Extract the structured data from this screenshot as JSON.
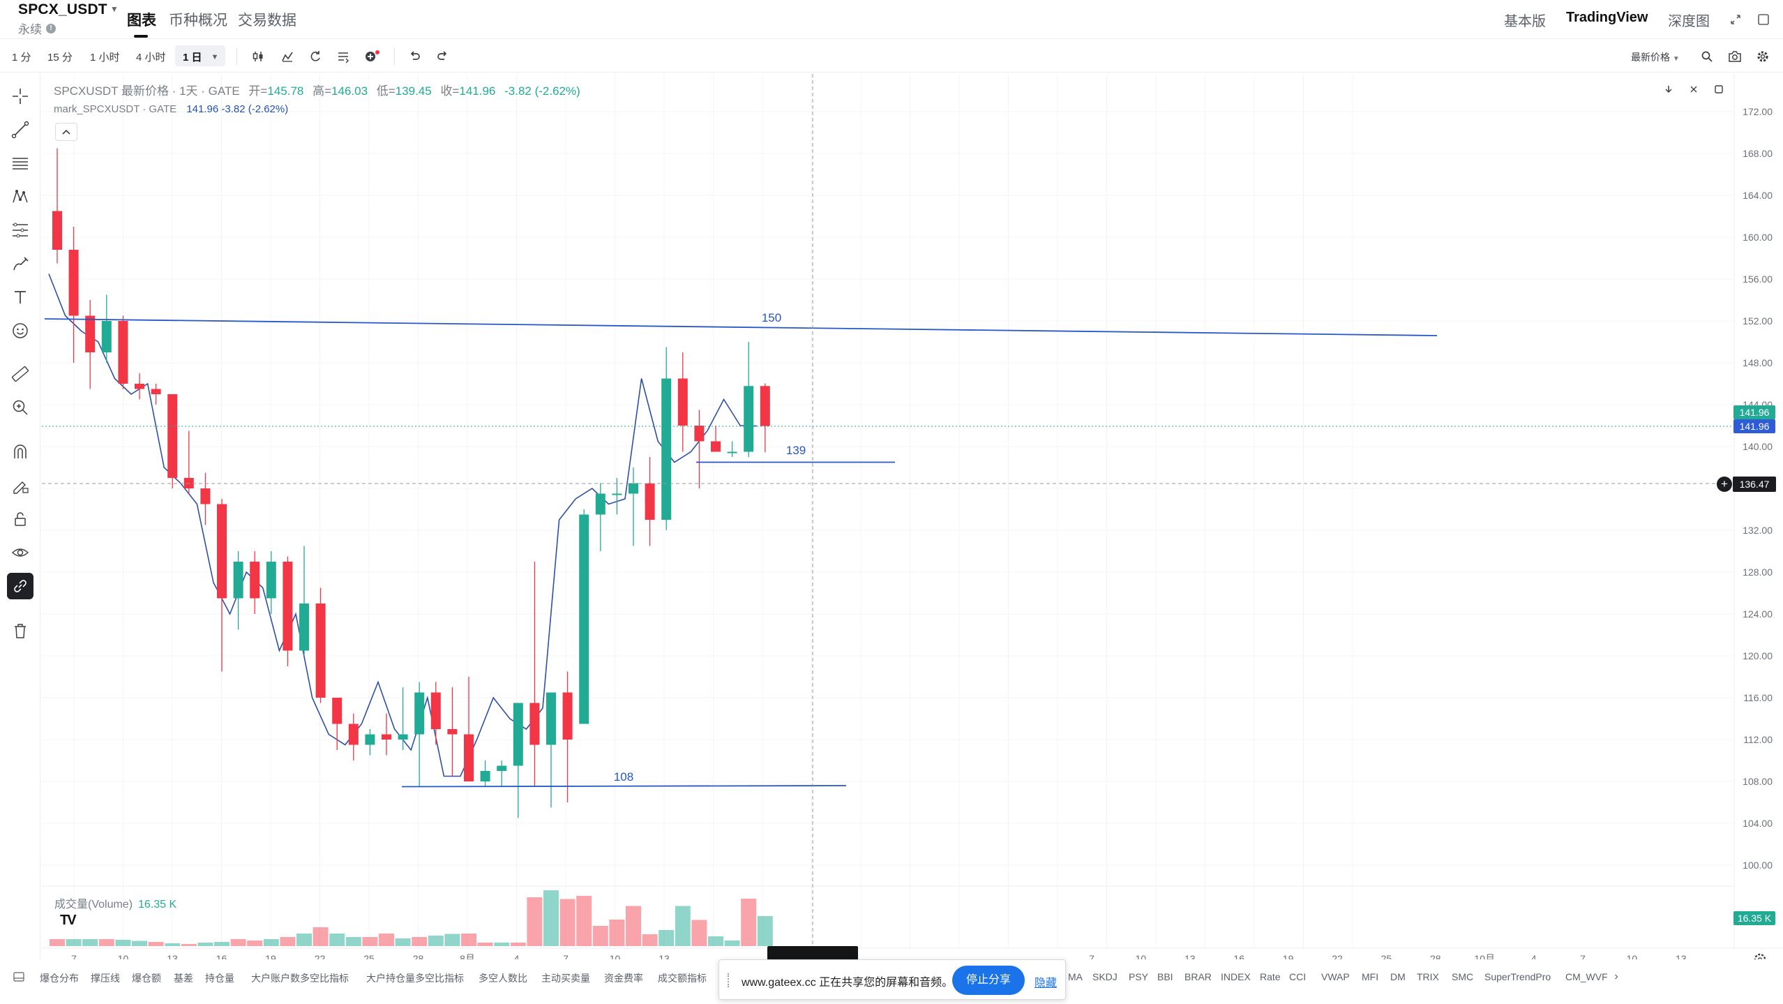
{
  "header": {
    "symbol": "SPCX_USDT",
    "subtype": "永续",
    "tabs": [
      "图表",
      "币种概况",
      "交易数据"
    ],
    "right_modes": [
      "基本版",
      "TradingView",
      "深度图"
    ]
  },
  "toolbar": {
    "timeframes": [
      "1 分",
      "15 分",
      "1 小时",
      "4 小时",
      "1 日"
    ],
    "price_source": "最新价格"
  },
  "legend": {
    "title": "SPCXUSDT 最新价格 · 1天 · GATE",
    "open_label": "开=",
    "open": "145.78",
    "high_label": "高=",
    "high": "146.03",
    "low_label": "低=",
    "low": "139.45",
    "close_label": "收=",
    "close": "141.96",
    "change": "-3.82 (-2.62%)",
    "mark_title": "mark_SPCXUSDT · GATE",
    "mark_value": "141.96 -3.82 (-2.62%)"
  },
  "volume_legend": {
    "label": "成交量(Volume)",
    "value": "16.35 K"
  },
  "price_tags": {
    "last_price": "141.96",
    "mark_price": "141.96",
    "crosshair_price": "136.47",
    "volume_tag": "16.35 K"
  },
  "colors": {
    "up": "#22ab94",
    "down": "#f23645",
    "drawing": "#2855c8",
    "mark_line": "#2c4fa8",
    "crosshair": "#9598a1"
  },
  "chart_data": {
    "type": "candlestick",
    "y_ticks": [
      "172.00",
      "168.00",
      "164.00",
      "160.00",
      "156.00",
      "152.00",
      "148.00",
      "144.00",
      "140.00",
      "136.00",
      "132.00",
      "128.00",
      "124.00",
      "120.00",
      "116.00",
      "112.00",
      "108.00",
      "104.00",
      "100.00"
    ],
    "x_ticks": [
      "7",
      "10",
      "13",
      "16",
      "19",
      "22",
      "25",
      "28",
      "8月",
      "4",
      "7",
      "10",
      "13",
      "16",
      "19",
      "22",
      "25",
      "28",
      "10月",
      "4",
      "7",
      "10",
      "13",
      "16"
    ],
    "x_ticks_visible": [
      "7",
      "10",
      "13",
      "16",
      "19",
      "22",
      "25",
      "28",
      "8月",
      "4",
      "7",
      "10",
      "13",
      "7",
      "10",
      "13",
      "16",
      "19",
      "22",
      "25",
      "28",
      "10月",
      "4",
      "7",
      "10",
      "13"
    ],
    "ohlc": [
      [
        162.5,
        168.5,
        157.5,
        158.8
      ],
      [
        158.8,
        161.0,
        148.0,
        152.5
      ],
      [
        152.5,
        154.0,
        145.5,
        149.0
      ],
      [
        149.0,
        154.5,
        148.0,
        152.0
      ],
      [
        152.0,
        152.5,
        145.5,
        146.0
      ],
      [
        146.0,
        147.0,
        144.5,
        145.5
      ],
      [
        145.5,
        146.0,
        144.0,
        145.0
      ],
      [
        145.0,
        145.0,
        136.0,
        137.0
      ],
      [
        137.0,
        141.5,
        135.5,
        136.0
      ],
      [
        136.0,
        137.5,
        132.5,
        134.5
      ],
      [
        134.5,
        135.0,
        118.5,
        125.5
      ],
      [
        125.5,
        130.0,
        122.5,
        129.0
      ],
      [
        129.0,
        130.0,
        124.0,
        125.5
      ],
      [
        125.5,
        130.0,
        124.0,
        129.0
      ],
      [
        129.0,
        129.5,
        119.0,
        120.5
      ],
      [
        120.5,
        130.5,
        120.0,
        125.0
      ],
      [
        125.0,
        126.5,
        115.5,
        116.0
      ],
      [
        116.0,
        116.0,
        111.0,
        113.5
      ],
      [
        113.5,
        114.5,
        110.0,
        111.5
      ],
      [
        111.5,
        113.0,
        110.5,
        112.5
      ],
      [
        112.5,
        114.5,
        110.5,
        112.0
      ],
      [
        112.0,
        117.0,
        111.0,
        112.5
      ],
      [
        112.5,
        117.5,
        107.5,
        116.5
      ],
      [
        116.5,
        117.5,
        111.5,
        113.0
      ],
      [
        113.0,
        117.0,
        108.5,
        112.5
      ],
      [
        112.5,
        118.0,
        108.0,
        108.0
      ],
      [
        108.0,
        110.0,
        107.5,
        109.0
      ],
      [
        109.0,
        110.0,
        107.5,
        109.5
      ],
      [
        109.5,
        115.5,
        104.5,
        115.5
      ],
      [
        115.5,
        129.0,
        107.5,
        111.5
      ],
      [
        111.5,
        116.0,
        105.5,
        116.5
      ],
      [
        116.5,
        118.5,
        106.0,
        112.0
      ],
      [
        113.5,
        134.0,
        113.5,
        133.5
      ],
      [
        133.5,
        136.5,
        130.0,
        135.5
      ],
      [
        135.5,
        137.0,
        133.5,
        135.5
      ],
      [
        135.5,
        138.0,
        130.5,
        136.5
      ],
      [
        136.5,
        139.0,
        130.5,
        133.0
      ],
      [
        133.0,
        149.5,
        132.0,
        146.5
      ],
      [
        146.5,
        149.0,
        139.5,
        142.0
      ],
      [
        142.0,
        143.5,
        136.0,
        140.5
      ],
      [
        140.5,
        142.0,
        139.5,
        139.5
      ],
      [
        139.5,
        140.5,
        139.0,
        139.5
      ],
      [
        139.5,
        150.0,
        139.0,
        145.78
      ],
      [
        145.78,
        146.03,
        139.45,
        141.96
      ]
    ],
    "mark_line": [
      156.5,
      152.5,
      151.0,
      150.0,
      146.5,
      145.0,
      146.0,
      138.0,
      136.5,
      134.5,
      127.0,
      124.0,
      128.0,
      126.5,
      120.5,
      124.0,
      116.0,
      112.5,
      111.5,
      113.5,
      117.5,
      113.0,
      111.0,
      116.0,
      108.5,
      108.5,
      112.0,
      116.0,
      114.0,
      113.0,
      115.0,
      133.0,
      135.0,
      136.0,
      134.5,
      135.0,
      146.5,
      140.5,
      138.5,
      139.5,
      141.5,
      144.5,
      142.0,
      141.96
    ],
    "volume": [
      2,
      2,
      2,
      2,
      1.8,
      1.5,
      1.2,
      0.8,
      0.6,
      1,
      1.2,
      2,
      1.6,
      2,
      2.6,
      3.6,
      5.4,
      3.6,
      2.6,
      2.6,
      3.6,
      2.2,
      2.6,
      3,
      3.5,
      3.6,
      1,
      1,
      1,
      14,
      16,
      13.5,
      14.4,
      5.8,
      7.6,
      11.5,
      3.4,
      4.6,
      11.5,
      7.5,
      2.8,
      1.6,
      13.6,
      8.6
    ],
    "volume_up": [
      false,
      true,
      true,
      false,
      true,
      true,
      false,
      true,
      false,
      true,
      true,
      false,
      false,
      true,
      false,
      true,
      false,
      true,
      true,
      false,
      false,
      true,
      false,
      true,
      true,
      false,
      false,
      true,
      false,
      false,
      true,
      false,
      false,
      false,
      false,
      false,
      false,
      true,
      true,
      false,
      true,
      true,
      false,
      true
    ],
    "drawings": [
      {
        "label": "150",
        "from": [
          0,
          152.2
        ],
        "to": [
          45,
          150.6
        ]
      },
      {
        "label": "139",
        "from": [
          33,
          138.5
        ],
        "to": [
          44,
          138.5
        ]
      },
      {
        "label": "108",
        "from": [
          15,
          107.5
        ],
        "to": [
          36,
          107.6
        ]
      }
    ],
    "crosshair_price": 136.47,
    "ylim": [
      98,
      174
    ]
  },
  "indicators": [
    "爆仓分布",
    "撑压线",
    "爆仓额",
    "基差",
    "持仓量",
    "大户账户数多空比指标",
    "大户持仓量多空比指标",
    "多空人数比",
    "主动买卖量",
    "资金费率",
    "成交额指标",
    "MA",
    "SKDJ",
    "PSY",
    "BBI",
    "BRAR",
    "INDEX",
    "Rate",
    "CCI",
    "VWAP",
    "MFI",
    "DM",
    "TRIX",
    "SMC",
    "SuperTrendPro",
    "CM_WVF"
  ],
  "share_popup": {
    "text": "www.gateex.cc 正在共享您的屏幕和音频。",
    "stop_button": "停止分享",
    "hide_link": "隐藏"
  }
}
